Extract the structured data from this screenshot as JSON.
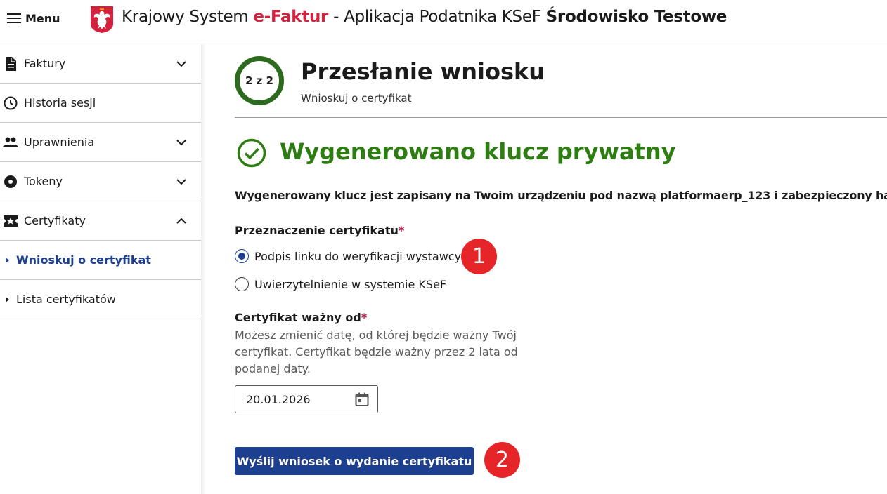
{
  "header": {
    "menu_label": "Menu",
    "title_prefix": "Krajowy System ",
    "title_brand": "e-Faktur",
    "title_middle": " - Aplikacja Podatnika KSeF ",
    "title_env": "Środowisko Testowe"
  },
  "sidebar": {
    "items": [
      {
        "label": "Faktury",
        "icon": "document-icon",
        "expandable": true
      },
      {
        "label": "Historia sesji",
        "icon": "clock-icon",
        "expandable": false
      },
      {
        "label": "Uprawnienia",
        "icon": "people-icon",
        "expandable": true
      },
      {
        "label": "Tokeny",
        "icon": "token-icon",
        "expandable": true
      },
      {
        "label": "Certyfikaty",
        "icon": "certificate-icon",
        "expandable": true,
        "expanded": true
      }
    ],
    "subitems": [
      {
        "label": "Wnioskuj o certyfikat",
        "active": true
      },
      {
        "label": "Lista certyfikatów",
        "active": false
      }
    ]
  },
  "step": {
    "label": "2 z 2"
  },
  "page": {
    "title": "Przesłanie wniosku",
    "subtitle": "Wnioskuj o certyfikat"
  },
  "success": {
    "title": "Wygenerowano klucz prywatny",
    "message": "Wygenerowany klucz jest zapisany na Twoim urządzeniu pod nazwą platformaerp_123 i zabezpieczony hasłem"
  },
  "purpose": {
    "label": "Przeznaczenie certyfikatu",
    "required_mark": "*",
    "options": [
      {
        "label": "Podpis linku do weryfikacji wystawcy",
        "checked": true
      },
      {
        "label": "Uwierzytelnienie w systemie KSeF",
        "checked": false
      }
    ]
  },
  "valid_from": {
    "label": "Certyfikat ważny od",
    "required_mark": "*",
    "hint": "Możesz zmienić datę, od której będzie ważny Twój certyfikat. Certyfikat będzie ważny przez 2 lata od podanej daty.",
    "value": "20.01.2026"
  },
  "submit": {
    "label": "Wyślij wniosek o wydanie certyfikatu"
  },
  "annotations": {
    "badge_1": "1",
    "badge_2": "2"
  },
  "colors": {
    "primary": "#1d3f8f",
    "success": "#2e7d12",
    "step_ring": "#2c6b1e",
    "brand_red": "#d4213d",
    "badge": "#e52528"
  }
}
